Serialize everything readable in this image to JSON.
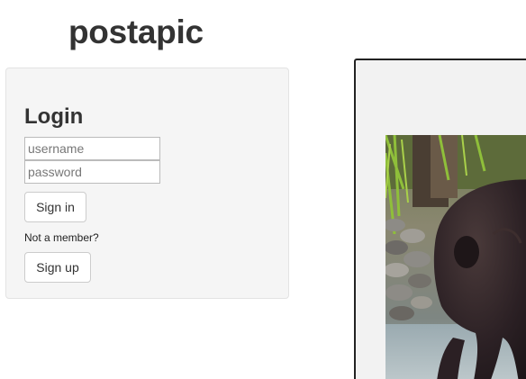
{
  "brand": {
    "title": "postapic"
  },
  "login": {
    "title": "Login",
    "username_placeholder": "username",
    "password_placeholder": "password",
    "signin_label": "Sign in",
    "not_member_text": "Not a member?",
    "signup_label": "Sign up"
  },
  "colors": {
    "panel_bg": "#f5f5f5",
    "frame_bg": "#f2f2f2",
    "text": "#333333"
  },
  "photo": {
    "subject": "bear-photo"
  }
}
